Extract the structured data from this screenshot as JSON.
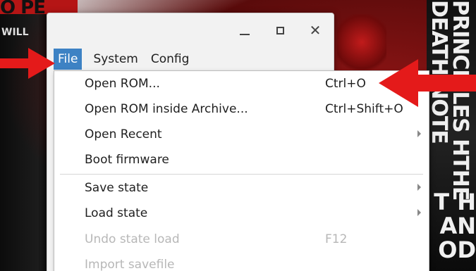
{
  "window": {
    "controls": {
      "minimize_icon": "minimize-icon",
      "maximize_icon": "maximize-icon",
      "close_icon": "close-icon",
      "close_glyph": "✕"
    }
  },
  "menubar": {
    "items": [
      {
        "label": "File"
      },
      {
        "label": "System"
      },
      {
        "label": "Config"
      }
    ]
  },
  "file_menu": {
    "items": [
      {
        "label": "Open ROM...",
        "shortcut": "Ctrl+O"
      },
      {
        "label": "Open ROM inside Archive...",
        "shortcut": "Ctrl+Shift+O"
      },
      {
        "label": "Open Recent",
        "submenu": true
      },
      {
        "label": "Boot firmware"
      },
      {
        "label": "Save state",
        "submenu": true
      },
      {
        "label": "Load state",
        "submenu": true
      },
      {
        "label": "Undo state load",
        "shortcut": "F12",
        "disabled": true
      },
      {
        "label": "Import savefile",
        "disabled": true
      }
    ]
  },
  "wallpaper": {
    "left_text": "O PE",
    "left_text2": "WILL",
    "right_text": "PRINCIPLES HTHE DEATH NOTE",
    "right_text2": "T H AN OD"
  },
  "colors": {
    "menu_highlight": "#3d82c4",
    "annotation_arrow": "#e41a1a",
    "disabled_text": "#b7b7b7"
  }
}
